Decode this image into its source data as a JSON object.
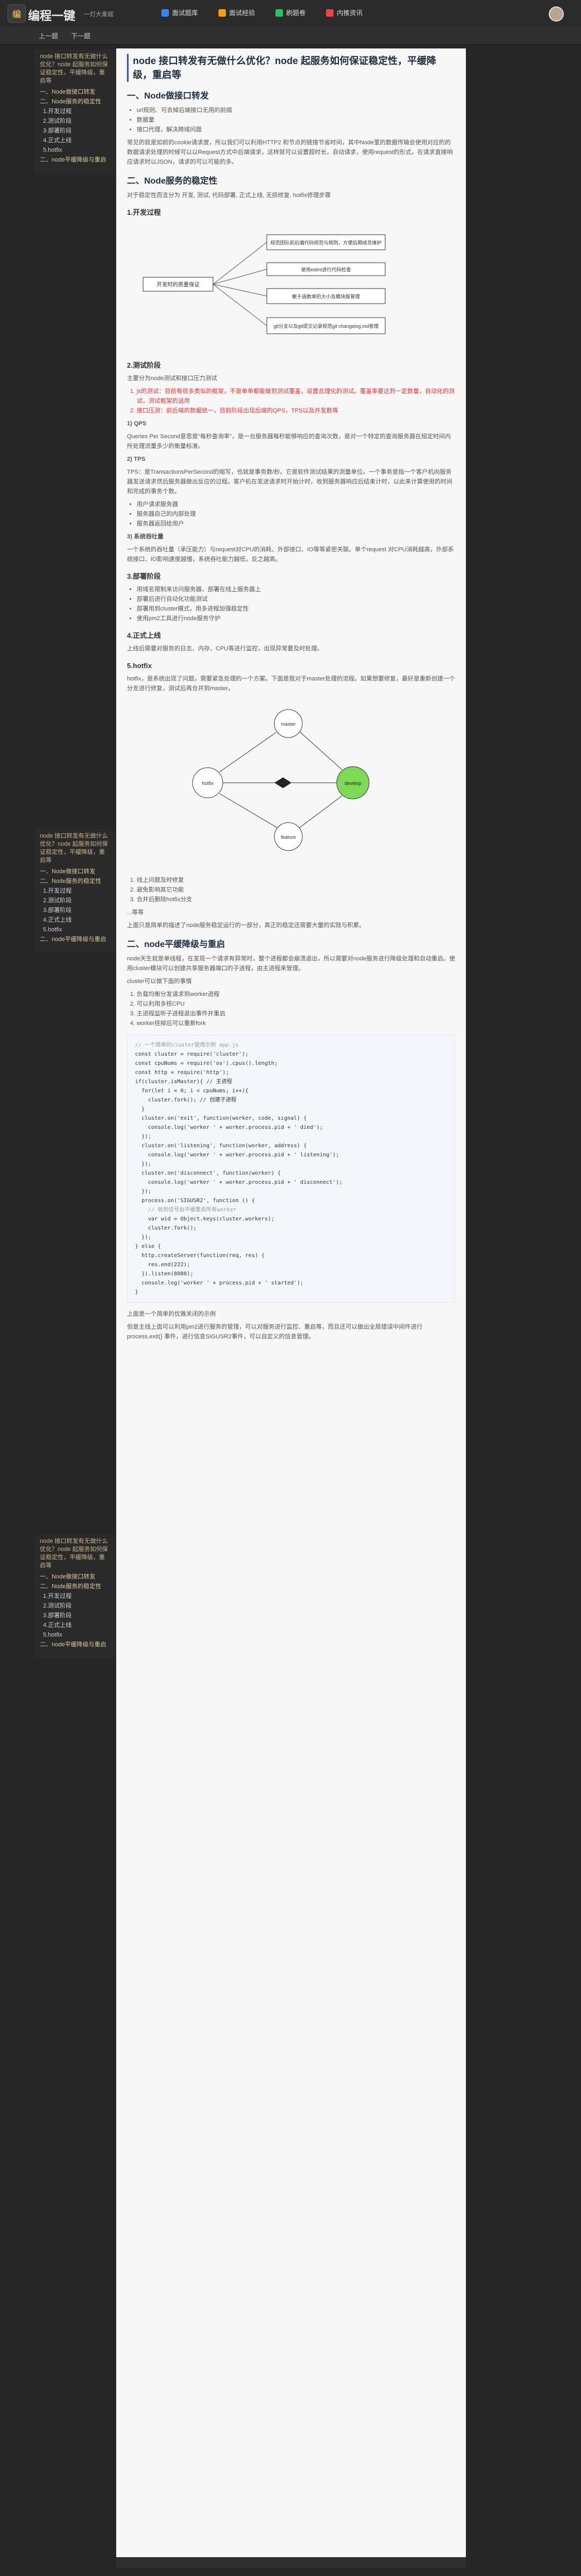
{
  "header": {
    "logo_char": "编",
    "brand": "编程一键",
    "slogan": "一灯大家庭",
    "nav": [
      {
        "label": "面试题库",
        "color": "#3b82f6"
      },
      {
        "label": "面试经验",
        "color": "#f59e0b"
      },
      {
        "label": "刷题卷",
        "color": "#22c55e"
      },
      {
        "label": "内推资讯",
        "color": "#ef4444"
      }
    ]
  },
  "subbar": {
    "prev": "上一题",
    "next": "下一题"
  },
  "sidebar": {
    "title": "node 接口转发有无做什么优化？node 起服务如何保证稳定性，平缓降级，重启等",
    "items": [
      {
        "t": "一、Node做接口转发",
        "cls": "sec"
      },
      {
        "t": "二、Node服务的稳定性",
        "cls": "sec"
      },
      {
        "t": "1.开发过程",
        "cls": "li"
      },
      {
        "t": "2.测试阶段",
        "cls": "li"
      },
      {
        "t": "3.部署阶段",
        "cls": "li"
      },
      {
        "t": "4.正式上线",
        "cls": "li"
      },
      {
        "t": "5.hotfix",
        "cls": "li"
      },
      {
        "t": "二、node平缓降级与重启",
        "cls": "sec"
      }
    ]
  },
  "article": {
    "title": "node 接口转发有无做什么优化？node 起服务如何保证稳定性，平缓降级，重启等",
    "h_forward": "一、Node做接口转发",
    "forward_list": [
      "url规则、可去掉后端接口无用的前缀",
      "数据量",
      "接口代理，解决跨域问题"
    ],
    "forward_text": "常见的就是如前的cookie请求度，所以我们可以利用HTTP2 和节点的链接节省时间，其中Node里的数据传输会使用对应的的数据请求处理的时候可以以Request方式中后端请求，这样就可以设置超时长，自动请求，使用request的形式，在请求直接响应请求时以JSON，请求的可以可能的多。",
    "h_stable": "二、Node服务的稳定性",
    "stable_intro": "对于稳定性而言分为 开发, 测试, 代码部署, 正式上线, 无损修复, hotfix修理步骤",
    "h_dev": "1.开发过程",
    "mind": {
      "center": "开发时的质量保证",
      "a": "规范团队前后端代码规范与规则，方便后期成员维护",
      "b": "使用eslint进行代码检查",
      "c": "敏于函数单的大小及模块版管理",
      "d": "git分支以及git提交记录规范git changelog.md管理"
    },
    "h_test": "2.测试阶段",
    "test_intro": "主要分为node测试和接口压力测试",
    "test_list": [
      "js的测试：目前有很多类似的框架，不是单单都能做到测试覆盖，设置合理化的测试。覆盖率要达到一定数量，自动化的测试，测试框架的运用",
      "接口压测：前后端的数据统一，目前阶段出现后端的QPS，TPS以及并发数等"
    ],
    "qps_title": "1) QPS",
    "qps_text": "Queries Per Second意思是\"每秒查询率\"，是一台服务器每秒能够响应的查询次数，是对一个特定的查询服务器在规定时间内所处理流量多少的衡量标准。",
    "tps_title": "2) TPS",
    "tps_text": "TPS：是TransactionsPerSecond的缩写，也就是事务数/秒。它是软件测试结果的测量单位。一个事务是指一个客户机向服务器发送请求然后服务器做出反应的过程。客户机在发送请求时开始计时，收到服务器响应后结束计时，以此来计算使用的时间和完成的事务个数。",
    "tps_list": [
      "用户请求服务器",
      "服务器自己的内部处理",
      "服务器返回给用户"
    ],
    "concurrency_title": "3) 系统吞吐量",
    "concurrency_text": "一个系统的吞吐量（承压能力）与request对CPU的消耗、外部接口、IO等等紧密关联。单个request 对CPU消耗越高，外部系统接口、IO影响速度越慢，系统吞吐能力越低，反之越高。",
    "h_deploy": "3.部署阶段",
    "deploy_list": [
      "用域名限制来访问服务器，部署在线上服务器上",
      "部署后进行自动化功能测试",
      "部署用到cluster模式，用多进程加强稳定性",
      "使用pm2工具进行node服务守护"
    ],
    "h_online": "4.正式上线",
    "online_text": "上线后需要对服务的日志、内存、CPU等进行监控，出现异常要及时处理。",
    "h_hotfix": "5.hotfix",
    "hotfix_text": "hotfix，是系统出现了问题，需要紧急处理的一个方案。下面是我对于master处理的流程。如果想要修复，最好是重新创建一个分支进行修复，测试后再合并到master。",
    "graph_nodes": [
      "master",
      "hotfix",
      "develop",
      "feature"
    ],
    "after_list": [
      "线上问题及时修复",
      "避免影响其它功能",
      "合并后删除hotfix分支"
    ],
    "summary_title": "...等等",
    "summary_text": "上面只是简单的描述了node服务稳定运行的一部分，真正的稳定还需要大量的实践与积累。",
    "h_downgrade": "二、node平缓降级与重启",
    "down_text": "node天生就是单线程，在发现一个请求有异常时，整个进程都会崩溃退出，所以需要对node服务进行降级处理和自动重启。使用cluster模块可以创建共享服务器端口的子进程，由主进程来管理。",
    "down_intro": "cluster可以做下面的事情",
    "down_list": [
      "负载均衡分发请求到worker进程",
      "可以利用多核CPU",
      "主进程监听子进程退出事件并重启",
      "worker挂掉后可以重新fork"
    ],
    "code": [
      {
        "k": "cm",
        "t": "// 一个简单的cluster使用示例 app.js"
      },
      {
        "k": "",
        "t": "const cluster = require('cluster');"
      },
      {
        "k": "",
        "t": "const cpuNums = require('os').cpus().length;"
      },
      {
        "k": "",
        "t": "const http = require('http');"
      },
      {
        "k": "",
        "t": ""
      },
      {
        "k": "",
        "t": "if(cluster.isMaster){ // 主进程"
      },
      {
        "k": "",
        "t": "  for(let i = 0; i < cpuNums; i++){"
      },
      {
        "k": "",
        "t": "    cluster.fork(); // 创建子进程"
      },
      {
        "k": "",
        "t": "  }"
      },
      {
        "k": "",
        "t": ""
      },
      {
        "k": "",
        "t": "  cluster.on('exit', function(worker, code, signal) {"
      },
      {
        "k": "",
        "t": "    console.log('worker ' + worker.process.pid + ' died');"
      },
      {
        "k": "",
        "t": "  });"
      },
      {
        "k": "",
        "t": ""
      },
      {
        "k": "",
        "t": "  cluster.on('listening', function(worker, address) {"
      },
      {
        "k": "",
        "t": "    console.log('worker ' + worker.process.pid + ' listening');"
      },
      {
        "k": "",
        "t": "  });"
      },
      {
        "k": "",
        "t": ""
      },
      {
        "k": "",
        "t": "  cluster.on('disconnect', function(worker) {"
      },
      {
        "k": "",
        "t": "    console.log('worker ' + worker.process.pid + ' disconnect');"
      },
      {
        "k": "",
        "t": "  });"
      },
      {
        "k": "",
        "t": ""
      },
      {
        "k": "",
        "t": "  process.on('SIGUSR2', function () {"
      },
      {
        "k": "cm",
        "t": "    // 收到信号后平缓重启所有worker"
      },
      {
        "k": "",
        "t": "    var wid = Object.keys(cluster.workers);"
      },
      {
        "k": "",
        "t": "    cluster.fork();"
      },
      {
        "k": "",
        "t": "  });"
      },
      {
        "k": "",
        "t": "} else {"
      },
      {
        "k": "",
        "t": "  http.createServer(function(req, res) {"
      },
      {
        "k": "",
        "t": "    res.end(222);"
      },
      {
        "k": "",
        "t": "  }).listen(8080);"
      },
      {
        "k": "",
        "t": ""
      },
      {
        "k": "",
        "t": "  console.log('worker ' + process.pid + ' started');"
      },
      {
        "k": "",
        "t": "}"
      }
    ],
    "end_title": "上面是一个简单的优雅关闭的示例",
    "end_text": "但是主线上面可以利用pm2进行服务的管理，可以对服务进行监控、重启等，而且还可以做出全局错误中间件进行 process.exit() 事件，进行信息SIGUSR2事件，可以自定义的信息管理。"
  }
}
